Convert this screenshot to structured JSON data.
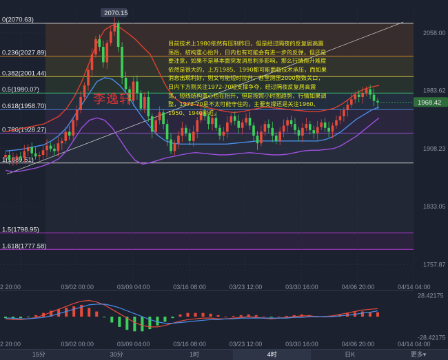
{
  "chart_data": [
    {
      "type": "candlestick",
      "x_ticks": [
        "2 20:00",
        "03/02 00:00",
        "03/09 04:00",
        "03/16 08:00",
        "03/23 12:00",
        "03/30 16:00",
        "04/06 20:00",
        "04/14 04:00"
      ],
      "y_ticks": [
        2058.0,
        1983.62,
        1908.23,
        1833.05,
        1757.87
      ],
      "ylim": [
        1735,
        2090
      ],
      "current_price": 1968.42,
      "peak_label": "2070.15",
      "peak_price": 2070.15,
      "fib_levels": [
        {
          "label": "0(2070.63)",
          "price": 2070.63,
          "color": "#d9d9d9"
        },
        {
          "label": "0.236(2027.89)",
          "price": 2027.89,
          "color": "#d58a2a"
        },
        {
          "label": "0.382(2001.44)",
          "price": 2001.44,
          "color": "#c8b838"
        },
        {
          "label": "0.5(1980.07)",
          "price": 1980.07,
          "color": "#3cb371"
        },
        {
          "label": "0.618(1958.70)",
          "price": 1958.7,
          "color": "#4a7fd0"
        },
        {
          "label": "0.786(1928.27)",
          "price": 1928.27,
          "color": "#8e4fc7"
        },
        {
          "label": "1(1889.51)",
          "price": 1889.51,
          "color": "#c8c8c8"
        },
        {
          "label": "1.5(1798.95)",
          "price": 1798.95,
          "color": "#b03ad0"
        },
        {
          "label": "1.618(1777.58)",
          "price": 1777.58,
          "color": "#b03ad0"
        }
      ],
      "close": [
        1900,
        1893,
        1895,
        1898,
        1896,
        1905,
        1910,
        1902,
        1898,
        1900,
        1906,
        1912,
        1908,
        1905,
        1915,
        1918,
        1930,
        1925,
        1945,
        1958,
        1975,
        1990,
        2010,
        2030,
        2050,
        2040,
        2020,
        2045,
        2060,
        2070,
        2040,
        2000,
        1985,
        1970,
        1995,
        1980,
        1960,
        1975,
        1950,
        1930,
        1945,
        1955,
        1940,
        1920,
        1905,
        1915,
        1925,
        1935,
        1928,
        1918,
        1930,
        1945,
        1955,
        1950,
        1940,
        1948,
        1935,
        1925,
        1930,
        1942,
        1950,
        1944,
        1935,
        1942,
        1948,
        1938,
        1925,
        1915,
        1930,
        1940,
        1935,
        1925,
        1918,
        1930,
        1938,
        1945,
        1940,
        1932,
        1925,
        1935,
        1940,
        1932,
        1928,
        1936,
        1942,
        1935,
        1930,
        1938,
        1945,
        1950,
        1958,
        1965,
        1972,
        1978,
        1975,
        1980,
        1985,
        1978,
        1970,
        1968
      ],
      "series": [
        {
          "name": "",
          "color": "#e0402e",
          "values": [
            1930,
            1932,
            1934,
            1936,
            1938,
            1940,
            1945,
            1950,
            1960,
            1975,
            1995,
            2020,
            2045,
            2062,
            2068,
            2065,
            2058,
            2050,
            2040,
            2030,
            2010,
            1990,
            1975,
            1968,
            1966,
            1965,
            1962,
            1960,
            1958,
            1956,
            1955,
            1956,
            1958,
            1960,
            1962,
            1961,
            1960,
            1959,
            1958,
            1957,
            1956,
            1956,
            1958,
            1960,
            1965,
            1972,
            1980,
            1985,
            1988,
            1990
          ]
        },
        {
          "name": "",
          "color": "#a050e0",
          "values": [
            1880,
            1878,
            1879,
            1881,
            1883,
            1886,
            1890,
            1895,
            1905,
            1920,
            1935,
            1945,
            1948,
            1945,
            1935,
            1920,
            1905,
            1893,
            1888,
            1890,
            1893,
            1896,
            1898,
            1900,
            1902,
            1903,
            1902,
            1901,
            1900,
            1900,
            1901,
            1902,
            1903,
            1902,
            1901,
            1900,
            1900,
            1901,
            1903,
            1905,
            1906,
            1906,
            1907,
            1908,
            1912,
            1918,
            1924,
            1932,
            1940,
            1948
          ]
        },
        {
          "name": "",
          "color": "#4a8ee8",
          "values": [
            1905,
            1906,
            1907,
            1909,
            1911,
            1913,
            1918,
            1925,
            1935,
            1950,
            1965,
            1980,
            1995,
            2000,
            1998,
            1990,
            1978,
            1962,
            1948,
            1936,
            1925,
            1918,
            1915,
            1914,
            1914,
            1914,
            1914,
            1914,
            1914,
            1914,
            1915,
            1916,
            1917,
            1918,
            1918,
            1918,
            1918,
            1918,
            1918,
            1918,
            1918,
            1918,
            1920,
            1924,
            1930,
            1938,
            1946,
            1952,
            1958,
            1962
          ]
        }
      ]
    },
    {
      "type": "macd",
      "y_ticks": [
        28.42175,
        -28.42175
      ],
      "ylim": [
        -30,
        30
      ],
      "x_ticks": [
        "2 20:00",
        "03/02 00:00",
        "03/09 04:00",
        "03/16 08:00",
        "03/23 12:00",
        "03/30 16:00",
        "04/06 20:00",
        "04/14 04:00"
      ],
      "dif": [
        -3,
        -4,
        -4,
        -3,
        -1,
        2,
        6,
        10,
        14,
        18,
        21,
        22,
        20,
        16,
        10,
        4,
        -2,
        -8,
        -12,
        -14,
        -14,
        -12,
        -9,
        -6,
        -4,
        -3,
        -2,
        -2,
        -3,
        -3,
        -2,
        -1,
        0,
        -1,
        -2,
        -3,
        -2,
        -1,
        0,
        1,
        1,
        0,
        0,
        1,
        3,
        5,
        7,
        9,
        10,
        11
      ],
      "dea": [
        -2,
        -2,
        -3,
        -3,
        -2,
        -1,
        1,
        4,
        7,
        10,
        13,
        16,
        17,
        17,
        15,
        12,
        8,
        4,
        0,
        -4,
        -7,
        -9,
        -9,
        -8,
        -7,
        -6,
        -5,
        -4,
        -4,
        -3,
        -3,
        -2,
        -2,
        -2,
        -2,
        -2,
        -2,
        -2,
        -1,
        -1,
        0,
        0,
        0,
        0,
        1,
        2,
        3,
        5,
        6,
        8
      ],
      "hist": [
        -2,
        -3,
        -2,
        -1,
        2,
        5,
        8,
        10,
        12,
        14,
        16,
        12,
        7,
        -1,
        -8,
        -14,
        -18,
        -20,
        -20,
        -17,
        -12,
        -7,
        -2,
        3,
        5,
        5,
        5,
        4,
        2,
        0,
        1,
        2,
        3,
        2,
        0,
        -1,
        0,
        1,
        2,
        3,
        2,
        0,
        0,
        1,
        3,
        5,
        6,
        7,
        6,
        6
      ]
    }
  ],
  "annotation": "目前技术上1980依然有压制昨日，但是经过隔夜的反复居高震荡后，结构重心抬升，日内也有可能会有进一步的反弹，但还是要注意，如果不是基本面突发消息利多影响，那么行情爬升难度依然是很大的，上方1985、1990都可能面临技术承压，而如果消息出现利好，则又可能短时拉升，甚至测压2000整数关口，日内下方则关注1972-70短支撑争夺，经过隔夜反复居高震荡，短线结构重心也在抬升，但是按照小时图趋势，行情如果调整，1972-70是不太可能守住的，主要支撑还是关注1960、1950、1940附近。",
  "watermark": "李逸轩",
  "tabs": [
    {
      "label": "15分",
      "active": false
    },
    {
      "label": "30分",
      "active": false
    },
    {
      "label": "1时",
      "active": false
    },
    {
      "label": "4时",
      "active": true
    },
    {
      "label": "日K",
      "active": false
    },
    {
      "label": "更多▾",
      "active": false
    }
  ]
}
